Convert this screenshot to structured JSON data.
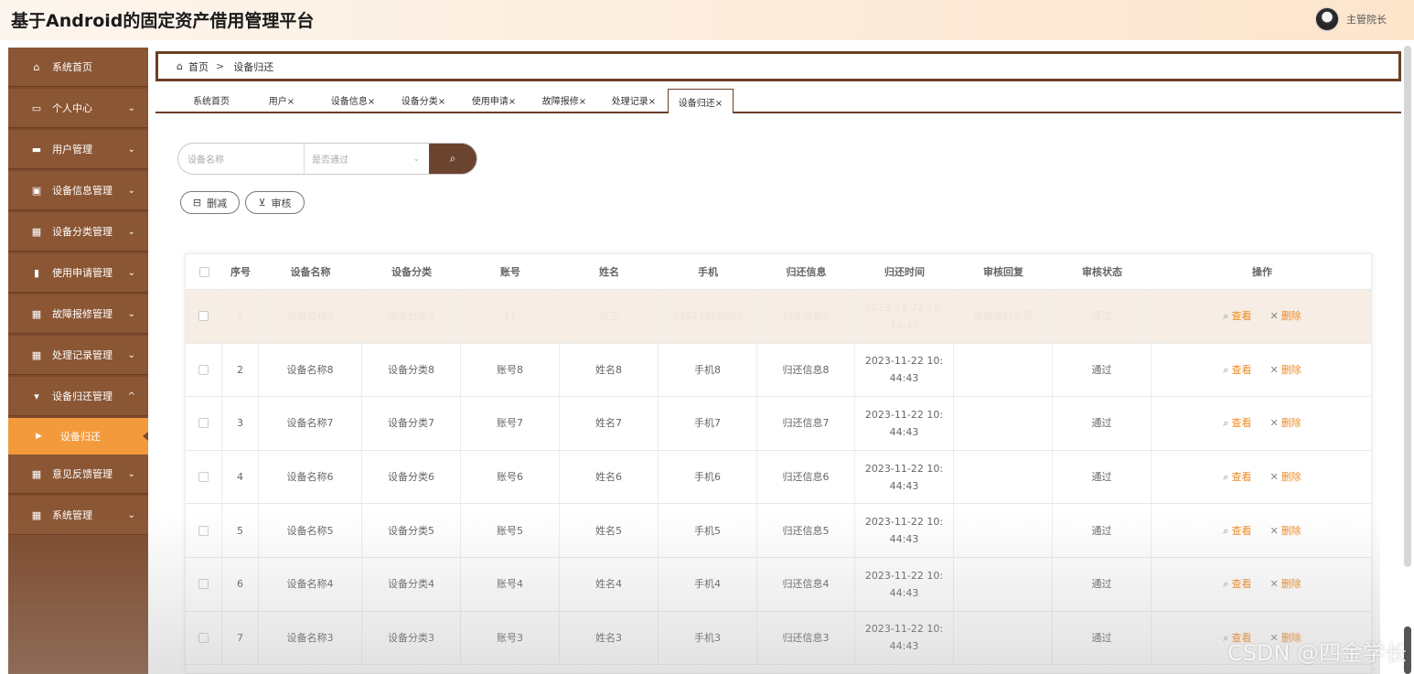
{
  "app": {
    "title": "基于Android的固定资产借用管理平台"
  },
  "user": {
    "name": "主管院长"
  },
  "sidebar": {
    "items": [
      {
        "label": "系统首页",
        "icon": "home-icon",
        "chevron": ""
      },
      {
        "label": "个人中心",
        "icon": "id-card-icon",
        "chevron": "⌄"
      },
      {
        "label": "用户管理",
        "icon": "monitor-icon",
        "chevron": "⌄"
      },
      {
        "label": "设备信息管理",
        "icon": "clipboard-icon",
        "chevron": "⌄"
      },
      {
        "label": "设备分类管理",
        "icon": "grid-icon",
        "chevron": "⌄"
      },
      {
        "label": "使用申请管理",
        "icon": "bar-chart-icon",
        "chevron": "⌄"
      },
      {
        "label": "故障报修管理",
        "icon": "grid-icon",
        "chevron": "⌄"
      },
      {
        "label": "处理记录管理",
        "icon": "grid-icon",
        "chevron": "⌄"
      },
      {
        "label": "设备归还管理",
        "icon": "signpost-icon",
        "chevron": "^"
      },
      {
        "label": "意见反馈管理",
        "icon": "grid-icon",
        "chevron": "⌄"
      },
      {
        "label": "系统管理",
        "icon": "grid-icon",
        "chevron": "⌄"
      }
    ],
    "sub_active": "设备归还"
  },
  "breadcrumb": {
    "home": "首页",
    "sep": ">",
    "current": "设备归还"
  },
  "tabs": [
    {
      "label": "系统首页"
    },
    {
      "label": "用户×"
    },
    {
      "label": "设备信息×"
    },
    {
      "label": "设备分类×"
    },
    {
      "label": "使用申请×"
    },
    {
      "label": "故障报修×"
    },
    {
      "label": "处理记录×"
    },
    {
      "label": "设备归还×"
    }
  ],
  "search": {
    "name_placeholder": "设备名称",
    "select_placeholder": "是否通过",
    "button_icon": "search-icon"
  },
  "actions": {
    "delete_label": "删减",
    "review_label": "审核"
  },
  "table": {
    "headers": [
      "序号",
      "设备名称",
      "设备分类",
      "账号",
      "姓名",
      "手机",
      "归还信息",
      "归还时间",
      "审核回复",
      "审核状态",
      "操作"
    ],
    "view_label": "查看",
    "delete_label": "删除",
    "rows": [
      {
        "no": "1",
        "name": "设备名称9",
        "category": "设备分类9",
        "account": "11",
        "person": "张三",
        "phone": "13823888881",
        "return_info": "归还信息9",
        "time": "2023-11-22 10:44:43",
        "reply": "设备完好无损",
        "status": "通过"
      },
      {
        "no": "2",
        "name": "设备名称8",
        "category": "设备分类8",
        "account": "账号8",
        "person": "姓名8",
        "phone": "手机8",
        "return_info": "归还信息8",
        "time": "2023-11-22 10:44:43",
        "reply": "",
        "status": "通过"
      },
      {
        "no": "3",
        "name": "设备名称7",
        "category": "设备分类7",
        "account": "账号7",
        "person": "姓名7",
        "phone": "手机7",
        "return_info": "归还信息7",
        "time": "2023-11-22 10:44:43",
        "reply": "",
        "status": "通过"
      },
      {
        "no": "4",
        "name": "设备名称6",
        "category": "设备分类6",
        "account": "账号6",
        "person": "姓名6",
        "phone": "手机6",
        "return_info": "归还信息6",
        "time": "2023-11-22 10:44:43",
        "reply": "",
        "status": "通过"
      },
      {
        "no": "5",
        "name": "设备名称5",
        "category": "设备分类5",
        "account": "账号5",
        "person": "姓名5",
        "phone": "手机5",
        "return_info": "归还信息5",
        "time": "2023-11-22 10:44:43",
        "reply": "",
        "status": "通过"
      },
      {
        "no": "6",
        "name": "设备名称4",
        "category": "设备分类4",
        "account": "账号4",
        "person": "姓名4",
        "phone": "手机4",
        "return_info": "归还信息4",
        "time": "2023-11-22 10:44:43",
        "reply": "",
        "status": "通过"
      },
      {
        "no": "7",
        "name": "设备名称3",
        "category": "设备分类3",
        "account": "账号3",
        "person": "姓名3",
        "phone": "手机3",
        "return_info": "归还信息3",
        "time": "2023-11-22 10:44:43",
        "reply": "",
        "status": "通过"
      }
    ]
  },
  "watermark": "CSDN @四金学长",
  "colors": {
    "sidebar": "#8b5634",
    "accent": "#f39a3c",
    "primary": "#6b4430",
    "link": "#f08a24"
  }
}
